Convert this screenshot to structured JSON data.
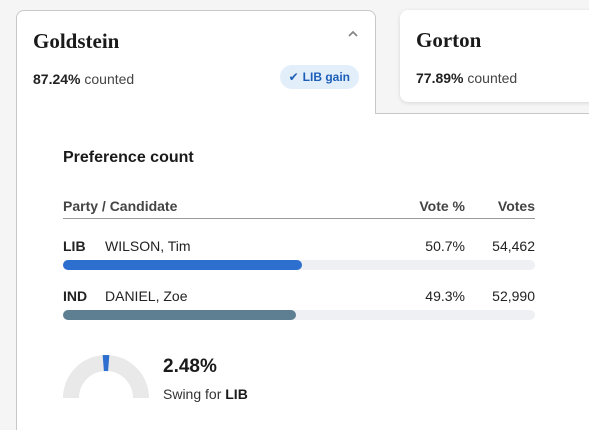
{
  "seats": [
    {
      "name": "Goldstein",
      "counted_pct": "87.24%",
      "counted_label": "counted",
      "badge": "LIB gain",
      "badge_icon": "check-icon",
      "expanded": true
    },
    {
      "name": "Gorton",
      "counted_pct": "77.89%",
      "counted_label": "counted"
    }
  ],
  "panel": {
    "heading": "Preference count",
    "columns": {
      "party": "Party / Candidate",
      "pct": "Vote %",
      "votes": "Votes"
    },
    "rows": [
      {
        "party": "LIB",
        "candidate": "WILSON, Tim",
        "pct": "50.7%",
        "votes": "54,462",
        "share": 0.507,
        "color": "#2d6fcf"
      },
      {
        "party": "IND",
        "candidate": "DANIEL, Zoe",
        "pct": "49.3%",
        "votes": "52,990",
        "share": 0.493,
        "color": "#5e7f92"
      }
    ],
    "swing": {
      "value": "2.48%",
      "label_prefix": "Swing for",
      "party": "LIB",
      "level": 0.0248,
      "color": "#2d6fcf"
    }
  },
  "colors": {
    "accent": "#2d6fcf",
    "badge_bg": "#e3eefb",
    "badge_text": "#1b5fb8",
    "track": "#eef0f3"
  }
}
